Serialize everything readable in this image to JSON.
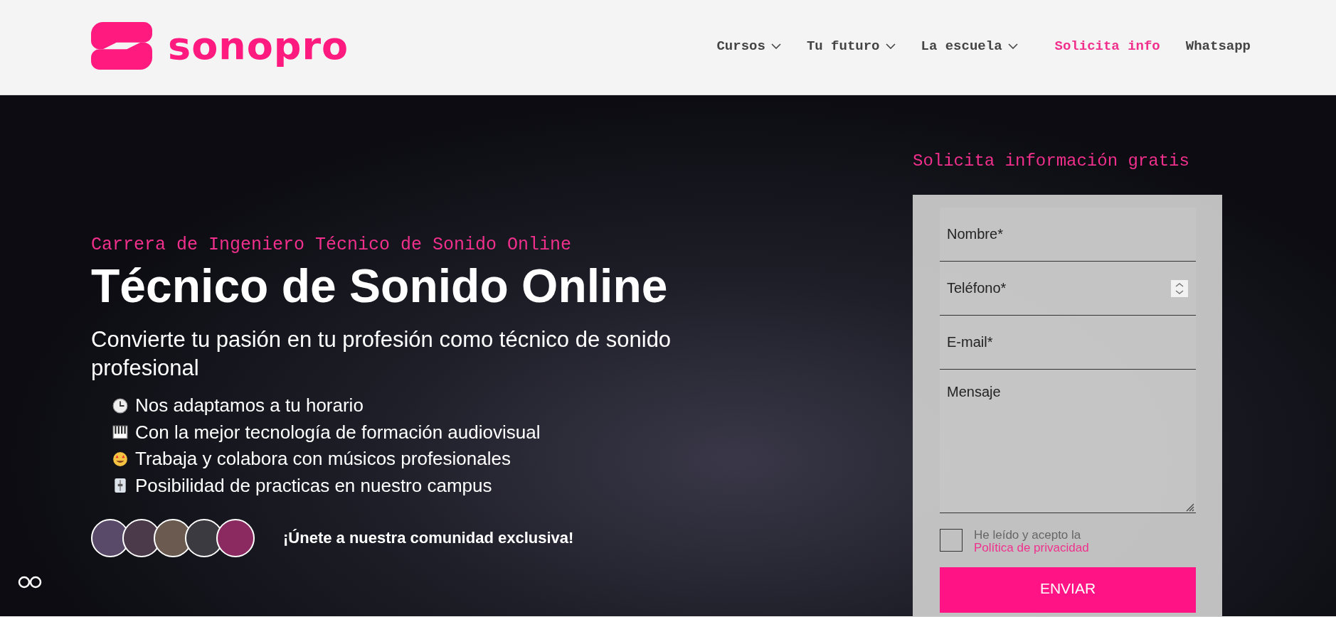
{
  "header": {
    "logo": {
      "text": "sonopro"
    },
    "nav": [
      {
        "label": "Cursos",
        "kind": "dropdown"
      },
      {
        "label": "Tu futuro",
        "kind": "dropdown"
      },
      {
        "label": "La escuela",
        "kind": "dropdown"
      },
      {
        "label": "Solicita info",
        "kind": "highlight"
      },
      {
        "label": "Whatsapp",
        "kind": "link"
      }
    ]
  },
  "hero": {
    "eyebrow": "Carrera de Ingeniero Técnico de Sonido Online",
    "title": "Técnico de Sonido Online",
    "lead": "Convierte tu pasión en tu profesión como técnico de sonido profesional",
    "bullets": [
      "Nos adaptamos a tu horario",
      "Con la mejor tecnología de formación audiovisual",
      "Trabaja y colabora con músicos profesionales",
      "Posibilidad de practicas en nuestro campus"
    ],
    "community": {
      "text": "¡Únete a nuestra comunidad exclusiva!"
    }
  },
  "form": {
    "title": "Solicita información gratis",
    "fields": [
      {
        "placeholder": "Nombre*",
        "kind": "text"
      },
      {
        "placeholder": "Teléfono*",
        "kind": "number"
      },
      {
        "placeholder": "E-mail*",
        "kind": "text"
      },
      {
        "placeholder": "Mensaje",
        "kind": "textarea"
      }
    ],
    "consent": {
      "checked": false,
      "text": "He leído y acepto la ",
      "link": "Política de privacidad"
    },
    "submit": "ENVIAR"
  }
}
